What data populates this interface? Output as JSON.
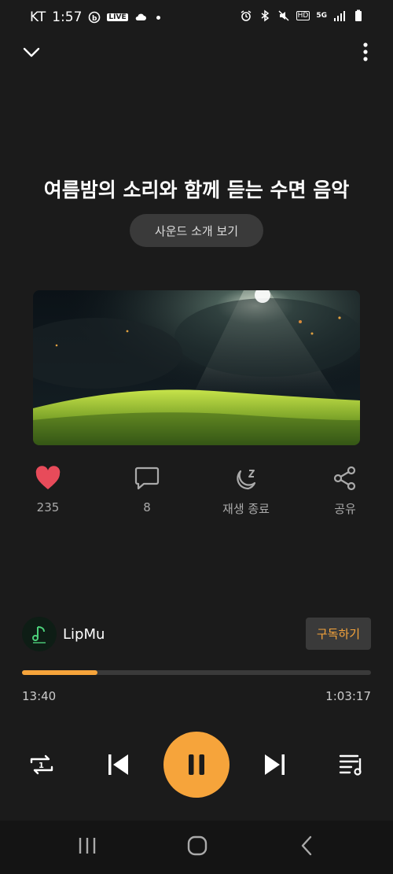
{
  "status_bar": {
    "carrier": "KT",
    "time": "1:57",
    "live_label": "LIVE",
    "network_label": "5G",
    "hd_label": "HD"
  },
  "track": {
    "title": "여름밤의 소리와 함께 듣는 수면 음악",
    "intro_button": "사운드 소개 보기"
  },
  "actions": {
    "like_count": "235",
    "comment_count": "8",
    "sleep_timer_label": "재생 종료",
    "share_label": "공유"
  },
  "channel": {
    "name": "LipMu",
    "subscribe_label": "구독하기"
  },
  "playback": {
    "current_time": "13:40",
    "total_time": "1:03:17",
    "progress_fraction": 0.216
  },
  "colors": {
    "accent": "#f6a43b",
    "like": "#e84b5a",
    "background": "#1b1b1b"
  }
}
